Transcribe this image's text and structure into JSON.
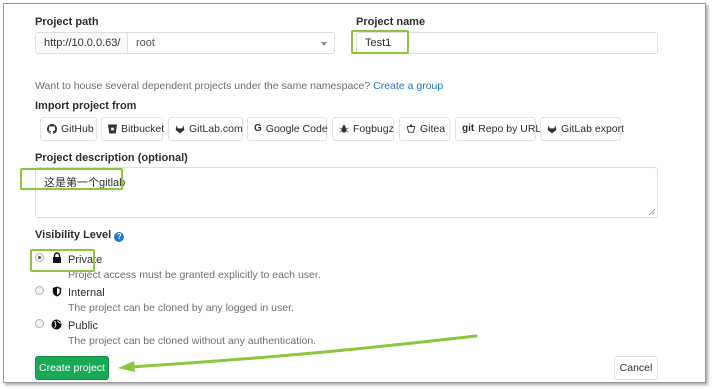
{
  "project_path": {
    "label": "Project path",
    "prefix": "http://10.0.0.63/",
    "namespace": "root"
  },
  "project_name": {
    "label": "Project name",
    "value": "Test1"
  },
  "namespace_hint": {
    "text": "Want to house several dependent projects under the same namespace?",
    "link": "Create a group"
  },
  "import": {
    "label": "Import project from",
    "buttons": [
      {
        "label": "GitHub",
        "icon": "github-icon"
      },
      {
        "label": "Bitbucket",
        "icon": "bitbucket-icon"
      },
      {
        "label": "GitLab.com",
        "icon": "gitlab-icon"
      },
      {
        "label": "Google Code",
        "icon": "google-icon"
      },
      {
        "label": "Fogbugz",
        "icon": "bug-icon"
      },
      {
        "label": "Gitea",
        "icon": "gitea-icon"
      },
      {
        "label": "Repo by URL",
        "icon": "git-icon",
        "icon_text": "git"
      },
      {
        "label": "GitLab export",
        "icon": "gitlab-icon"
      }
    ]
  },
  "description": {
    "label": "Project description (optional)",
    "value": "这是第一个gitlab"
  },
  "visibility": {
    "label": "Visibility Level",
    "help_icon": "question-circle-icon",
    "selected": "Private",
    "options": [
      {
        "title": "Private",
        "icon": "lock-icon",
        "description": "Project access must be granted explicitly to each user."
      },
      {
        "title": "Internal",
        "icon": "shield-icon",
        "description": "The project can be cloned by any logged in user."
      },
      {
        "title": "Public",
        "icon": "globe-icon",
        "description": "The project can be cloned without any authentication."
      }
    ]
  },
  "actions": {
    "create": "Create project",
    "cancel": "Cancel"
  },
  "colors": {
    "create_button": "#1aaa55",
    "link": "#1f78d1",
    "highlight": "#8cc63f"
  }
}
